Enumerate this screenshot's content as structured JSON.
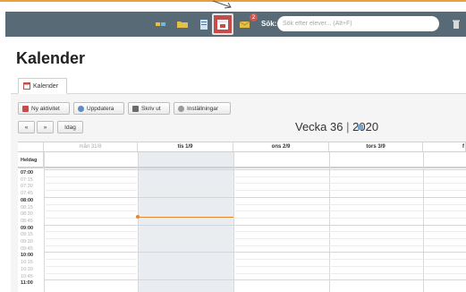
{
  "topbar": {
    "icons": [
      "apps-icon",
      "folder-icon",
      "document-icon",
      "calendar-icon",
      "messages-icon",
      "trash-icon"
    ],
    "badge_count": "2",
    "search_label": "Sök:",
    "search_placeholder": "Sök efter elever... (Alt+F)"
  },
  "page": {
    "title": "Kalender"
  },
  "tabs": [
    {
      "label": "Kalender"
    }
  ],
  "toolbar": {
    "new_activity": "Ny aktivitet",
    "refresh": "Uppdatera",
    "print": "Skriv ut",
    "settings": "Inställningar",
    "prev": "«",
    "next": "»",
    "today": "Idag"
  },
  "week": {
    "week_label": "Vecka 36",
    "separator": "|",
    "year": "2020"
  },
  "calendar": {
    "days": [
      "mån 31/8",
      "tis 1/9",
      "ons 2/9",
      "tors 3/9",
      "f"
    ],
    "allday_label": "Heldag",
    "times": [
      "07:00",
      "07:15",
      "07:30",
      "07:45",
      "08:00",
      "08:15",
      "08:30",
      "08:45",
      "09:00",
      "09:15",
      "09:30",
      "09:45",
      "10:00",
      "10:15",
      "10:30",
      "10:45",
      "11:00"
    ]
  },
  "colors": {
    "accent": "#e8a13a",
    "topbar": "#586a76",
    "active_icon": "#c84b4b",
    "now_line": "#e08a2c"
  }
}
